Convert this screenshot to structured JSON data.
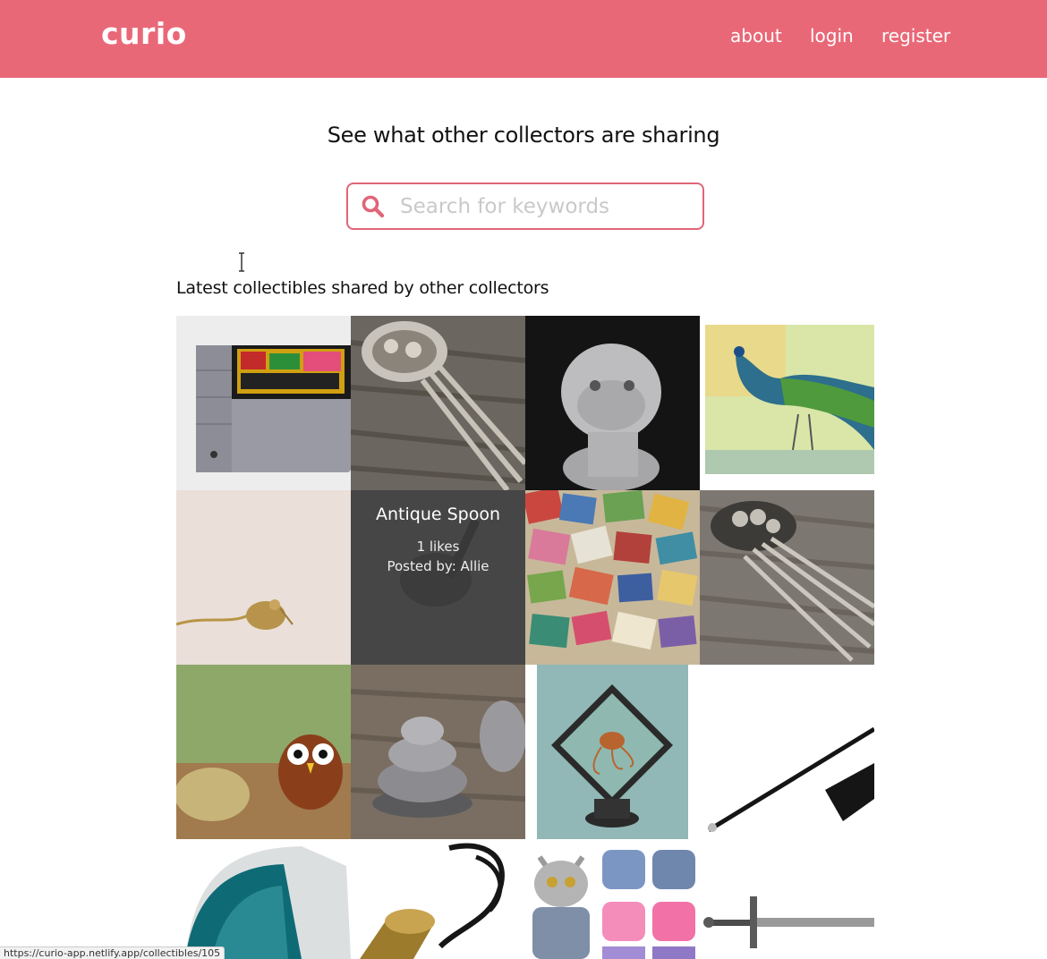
{
  "brand": {
    "name": "curio",
    "color": "#e96877"
  },
  "nav": {
    "about": "about",
    "login": "login",
    "register": "register"
  },
  "hero": {
    "title": "See what other collectors are sharing"
  },
  "search": {
    "placeholder": "Search for keywords",
    "value": "",
    "icon": "magnifier-icon"
  },
  "feed": {
    "title": "Latest collectibles shared by other collectors",
    "hovered": {
      "title": "Antique Spoon",
      "likes": "1 likes",
      "posted_by": "Posted by: Allie"
    },
    "items": [
      "snes-game-cartridge",
      "filigree-hair-pin",
      "bulldog-figurine",
      "peacock-watercolor",
      "kiwi-bird-pendant",
      "antique-spoon",
      "postage-stamps",
      "antique-hair-comb",
      "glass-owl-figurine",
      "metal-stacked-knob",
      "octopus-specimen-frame",
      "riding-crop",
      "imac-g3",
      "brass-horn-pendant",
      "cat-sweaters",
      "fantasy-sword"
    ]
  },
  "status": {
    "url": "https://curio-app.netlify.app/collectibles/105"
  }
}
